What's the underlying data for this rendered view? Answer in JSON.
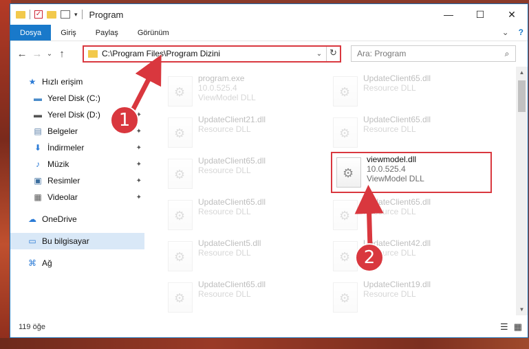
{
  "window": {
    "title": "Program",
    "minimize": "—",
    "maximize": "☐",
    "close": "✕"
  },
  "ribbon": {
    "tabs": [
      "Dosya",
      "Giriş",
      "Paylaş",
      "Görünüm"
    ],
    "collapse": "⌄",
    "help": "?"
  },
  "nav": {
    "back": "←",
    "forward": "→",
    "recent": "⌄",
    "up": "↑"
  },
  "address": {
    "path": "C:\\Program Files\\Program Dizini",
    "dropdown": "⌄",
    "refresh": "↻"
  },
  "search": {
    "placeholder": "Ara: Program",
    "icon": "⌕"
  },
  "sidebar": {
    "items": [
      {
        "label": "Hızlı erişim",
        "icon": "★",
        "color": "#2b7bd6",
        "pinned": false
      },
      {
        "label": "Yerel Disk (C:)",
        "icon": "▬",
        "color": "#4a8bc9",
        "pinned": true
      },
      {
        "label": "Yerel Disk (D:)",
        "icon": "▬",
        "color": "#555555",
        "pinned": true
      },
      {
        "label": "Belgeler",
        "icon": "▤",
        "color": "#5a7fa8",
        "pinned": true
      },
      {
        "label": "İndirmeler",
        "icon": "⬇",
        "color": "#2b7bd6",
        "pinned": true
      },
      {
        "label": "Müzik",
        "icon": "♪",
        "color": "#2b7bd6",
        "pinned": true
      },
      {
        "label": "Resimler",
        "icon": "▣",
        "color": "#3c6e9e",
        "pinned": true
      },
      {
        "label": "Videolar",
        "icon": "▦",
        "color": "#555555",
        "pinned": true
      },
      {
        "label": "OneDrive",
        "icon": "☁",
        "color": "#2b7bd6",
        "pinned": false
      },
      {
        "label": "Bu bilgisayar",
        "icon": "▭",
        "color": "#2b7bd6",
        "pinned": false
      },
      {
        "label": "Ağ",
        "icon": "⌘",
        "color": "#2b7bd6",
        "pinned": false
      }
    ],
    "pin_glyph": "📌"
  },
  "files": [
    {
      "name": "program.exe",
      "ver": "10.0.525.4",
      "desc": "ViewModel DLL"
    },
    {
      "name": "UpdateClient65.dll",
      "ver": "",
      "desc": "Resource DLL"
    },
    {
      "name": "UpdateClient21.dll",
      "ver": "",
      "desc": "Resource DLL"
    },
    {
      "name": "UpdateClient65.dll",
      "ver": "",
      "desc": "Resource DLL"
    },
    {
      "name": "UpdateClient65.dll",
      "ver": "",
      "desc": "Resource DLL"
    },
    {
      "name": "viewmodel.dll",
      "ver": "10.0.525.4",
      "desc": "ViewModel DLL"
    },
    {
      "name": "UpdateClient65.dll",
      "ver": "",
      "desc": "Resource DLL"
    },
    {
      "name": "UpdateClient65.dll",
      "ver": "",
      "desc": "Resource DLL"
    },
    {
      "name": "UpdateClient5.dll",
      "ver": "",
      "desc": "Resource DLL"
    },
    {
      "name": "UpdateClient42.dll",
      "ver": "",
      "desc": "Resource DLL"
    },
    {
      "name": "UpdateClient65.dll",
      "ver": "",
      "desc": "Resource DLL"
    },
    {
      "name": "UpdateClient19.dll",
      "ver": "",
      "desc": "Resource DLL"
    }
  ],
  "status": {
    "count": "119 öğe",
    "view_details": "☰",
    "view_tiles": "▦"
  },
  "annotations": {
    "step1": "1",
    "step2": "2",
    "color": "#d9373e"
  }
}
